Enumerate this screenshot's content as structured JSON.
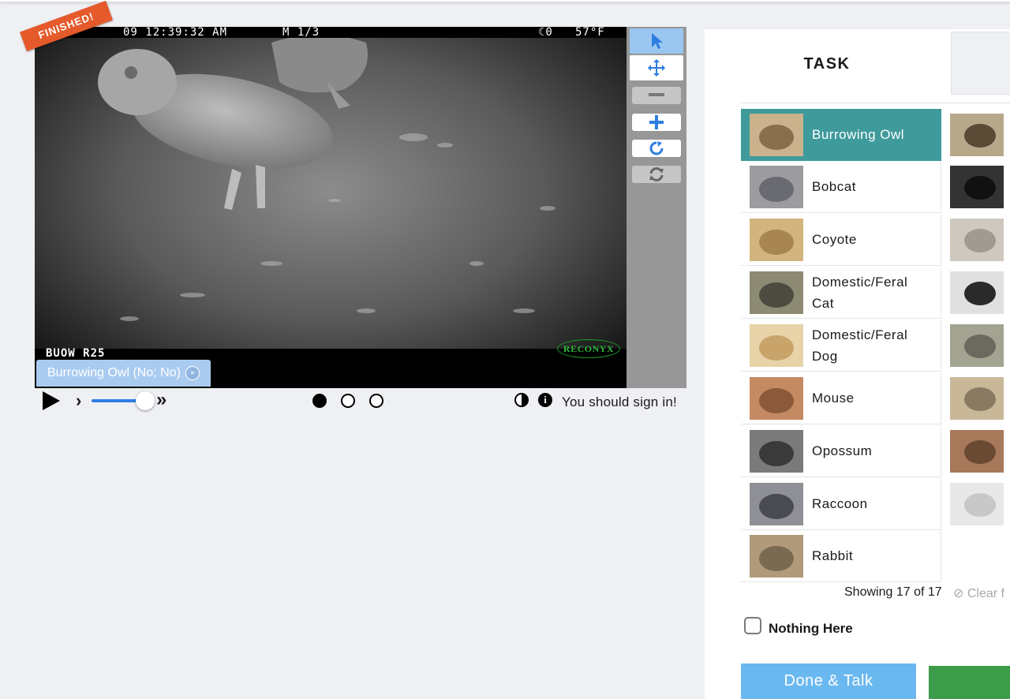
{
  "viewer": {
    "finished_banner": "FINISHED!",
    "camera_timestamp": "09 12:39:32 AM",
    "camera_frame": "M 1/3",
    "camera_moon": "☾0",
    "camera_temp": "57°F",
    "camera_id": "BUOW R25",
    "camera_brand": "RECONYX",
    "annotation_chip": "Burrowing Owl (No; No)",
    "tools": [
      "pointer-icon",
      "move-icon",
      "zoom-out-icon",
      "zoom-in-icon",
      "rotate-icon",
      "reset-icon"
    ]
  },
  "controls": {
    "sign_in": "You should sign in!",
    "frames": {
      "count": 3,
      "current": 1
    }
  },
  "task": {
    "tab_label": "TASK",
    "choices": [
      {
        "label": "Burrowing Owl",
        "selected": true
      },
      {
        "label": "Bobcat",
        "selected": false
      },
      {
        "label": "Coyote",
        "selected": false
      },
      {
        "label": "Domestic/Feral Cat",
        "selected": false
      },
      {
        "label": "Domestic/Feral Dog",
        "selected": false
      },
      {
        "label": "Mouse",
        "selected": false
      },
      {
        "label": "Opossum",
        "selected": false
      },
      {
        "label": "Raccoon",
        "selected": false
      },
      {
        "label": "Rabbit",
        "selected": false
      }
    ],
    "showing": "Showing 17 of 17",
    "clear_filters": "Clear f",
    "nothing_here": "Nothing Here",
    "done_talk": "Done & Talk"
  },
  "colors": {
    "selected_choice": "#3f9a9c",
    "accent_blue": "#2e7de1",
    "finished_banner": "#e55a2b",
    "done_talk": "#6ab8f0",
    "done": "#3d9c4a"
  }
}
